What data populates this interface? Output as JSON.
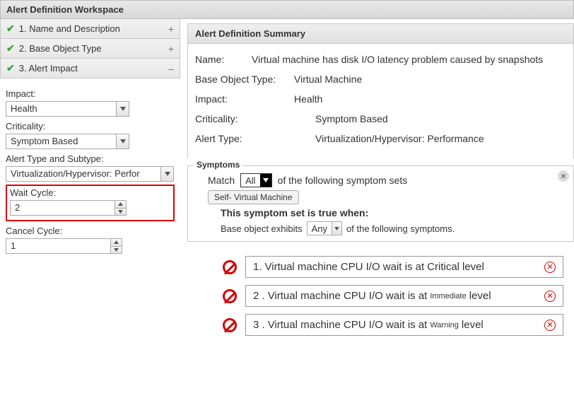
{
  "workspace_title": "Alert Definition Workspace",
  "steps": [
    {
      "label": "1. Name and Description",
      "expander": "+"
    },
    {
      "label": "2. Base Object Type",
      "expander": "+"
    },
    {
      "label": "3. Alert Impact",
      "expander": "–"
    }
  ],
  "form": {
    "impact_label": "Impact:",
    "impact_value": "Health",
    "criticality_label": "Criticality:",
    "criticality_value": "Symptom Based",
    "alerttype_label": "Alert Type and Subtype:",
    "alerttype_value": "Virtualization/Hypervisor: Perfor",
    "waitcycle_label": "Wait Cycle:",
    "waitcycle_value": "2",
    "cancelcycle_label": "Cancel Cycle:",
    "cancelcycle_value": "1"
  },
  "summary": {
    "header": "Alert Definition Summary",
    "rows": {
      "name_k": "Name:",
      "name_v": "Virtual machine has disk I/O latency problem caused by snapshots",
      "bot_k": "Base Object Type:",
      "bot_v": "Virtual Machine",
      "impact_k": "Impact:",
      "impact_v": "Health",
      "crit_k": "Criticality:",
      "crit_v": "Symptom Based",
      "atype_k": "Alert Type:",
      "atype_v": "Virtualization/Hypervisor: Performance"
    }
  },
  "symptoms": {
    "legend": "Symptoms",
    "match_pre": "Match",
    "match_value": "All",
    "match_post": "of the following symptom sets",
    "scope_tab": "Self- Virtual Machine",
    "set_true": "This symptom set is true when:",
    "base_pre": "Base object exhibits",
    "base_value": "Any",
    "base_post": "of the following symptoms."
  },
  "symptom_items": [
    {
      "num": "1.",
      "pre": "Virtual machine CPU I/O wait is at ",
      "level": "Critical",
      "small": false,
      "post": " level"
    },
    {
      "num": "2 .",
      "pre": "Virtual machine CPU I/O wait is at",
      "level": "Immediate",
      "small": true,
      "post": "level"
    },
    {
      "num": "3 .",
      "pre": "Virtual machine CPU I/O wait is at ",
      "level": "Warning",
      "small": true,
      "post": " level"
    }
  ]
}
